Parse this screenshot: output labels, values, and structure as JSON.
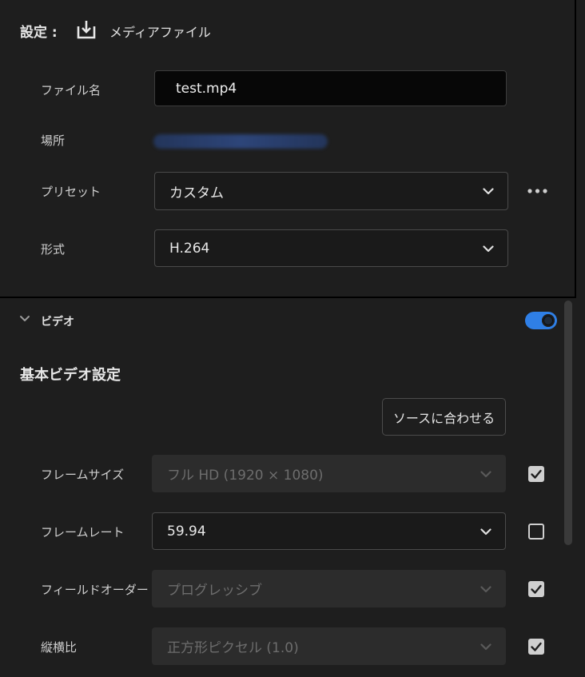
{
  "header": {
    "title": "設定 :",
    "destination_icon": "export-download-icon",
    "destination_label": "メディアファイル"
  },
  "fields": {
    "file_name": {
      "label": "ファイル名",
      "value": "test.mp4"
    },
    "location": {
      "label": "場所"
    },
    "preset": {
      "label": "プリセット",
      "value": "カスタム",
      "more_icon": "more-horizontal-icon"
    },
    "format": {
      "label": "形式",
      "value": "H.264"
    }
  },
  "video_section": {
    "label": "ビデオ",
    "enabled": true,
    "subheading": "基本ビデオ設定",
    "match_source_label": "ソースに合わせる",
    "rows": [
      {
        "label": "フレームサイズ",
        "value": "フル HD (1920 × 1080)",
        "disabled": true,
        "match_source": true
      },
      {
        "label": "フレームレート",
        "value": "59.94",
        "disabled": false,
        "match_source": false
      },
      {
        "label": "フィールドオーダー",
        "value": "プログレッシブ",
        "disabled": true,
        "match_source": true
      },
      {
        "label": "縦横比",
        "value": "正方形ピクセル (1.0)",
        "disabled": true,
        "match_source": true
      }
    ]
  },
  "colors": {
    "background": "#1e1e1e",
    "toggle_on": "#2f7fe6",
    "input_background": "#070707"
  }
}
